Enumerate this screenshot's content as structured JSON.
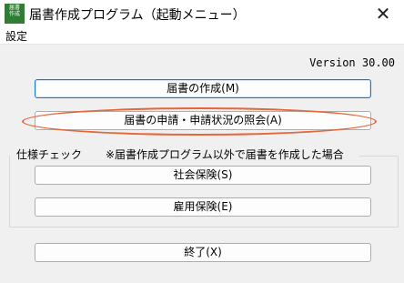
{
  "window": {
    "title": "届書作成プログラム（起動メニュー）",
    "close": "✕"
  },
  "app_icon": {
    "lines": [
      "届書",
      "作成"
    ]
  },
  "menu": {
    "settings": "設定"
  },
  "version": "Version 30.00",
  "buttons": {
    "create": "届書の作成(M)",
    "inquiry": "届書の申請・申請状況の照会(A)",
    "social_insurance": "社会保険(S)",
    "employment_insurance": "雇用保険(E)",
    "exit": "終了(X)"
  },
  "spec_group": {
    "title": "仕様チェック",
    "note": "※届書作成プログラム以外で届書を作成した場合"
  },
  "colors": {
    "highlight": "#e8653a",
    "focus": "#1a73d6",
    "icon": "#2e7d32"
  }
}
